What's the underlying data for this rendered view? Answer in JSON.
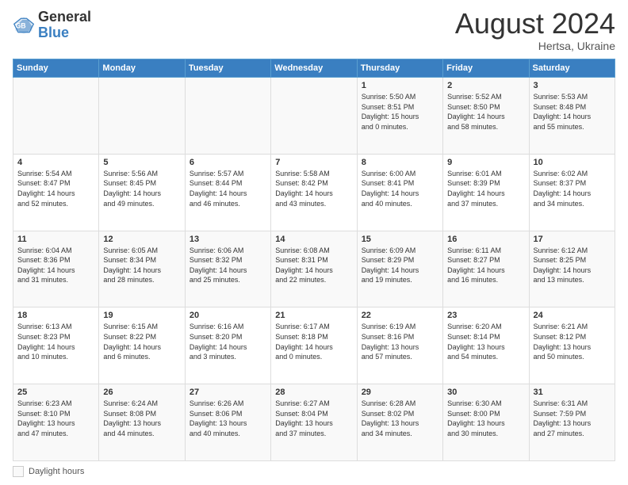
{
  "logo": {
    "line1": "General",
    "line2": "Blue"
  },
  "title": "August 2024",
  "subtitle": "Hertsa, Ukraine",
  "days_header": [
    "Sunday",
    "Monday",
    "Tuesday",
    "Wednesday",
    "Thursday",
    "Friday",
    "Saturday"
  ],
  "legend_label": "Daylight hours",
  "weeks": [
    [
      {
        "num": "",
        "info": ""
      },
      {
        "num": "",
        "info": ""
      },
      {
        "num": "",
        "info": ""
      },
      {
        "num": "",
        "info": ""
      },
      {
        "num": "1",
        "info": "Sunrise: 5:50 AM\nSunset: 8:51 PM\nDaylight: 15 hours\nand 0 minutes."
      },
      {
        "num": "2",
        "info": "Sunrise: 5:52 AM\nSunset: 8:50 PM\nDaylight: 14 hours\nand 58 minutes."
      },
      {
        "num": "3",
        "info": "Sunrise: 5:53 AM\nSunset: 8:48 PM\nDaylight: 14 hours\nand 55 minutes."
      }
    ],
    [
      {
        "num": "4",
        "info": "Sunrise: 5:54 AM\nSunset: 8:47 PM\nDaylight: 14 hours\nand 52 minutes."
      },
      {
        "num": "5",
        "info": "Sunrise: 5:56 AM\nSunset: 8:45 PM\nDaylight: 14 hours\nand 49 minutes."
      },
      {
        "num": "6",
        "info": "Sunrise: 5:57 AM\nSunset: 8:44 PM\nDaylight: 14 hours\nand 46 minutes."
      },
      {
        "num": "7",
        "info": "Sunrise: 5:58 AM\nSunset: 8:42 PM\nDaylight: 14 hours\nand 43 minutes."
      },
      {
        "num": "8",
        "info": "Sunrise: 6:00 AM\nSunset: 8:41 PM\nDaylight: 14 hours\nand 40 minutes."
      },
      {
        "num": "9",
        "info": "Sunrise: 6:01 AM\nSunset: 8:39 PM\nDaylight: 14 hours\nand 37 minutes."
      },
      {
        "num": "10",
        "info": "Sunrise: 6:02 AM\nSunset: 8:37 PM\nDaylight: 14 hours\nand 34 minutes."
      }
    ],
    [
      {
        "num": "11",
        "info": "Sunrise: 6:04 AM\nSunset: 8:36 PM\nDaylight: 14 hours\nand 31 minutes."
      },
      {
        "num": "12",
        "info": "Sunrise: 6:05 AM\nSunset: 8:34 PM\nDaylight: 14 hours\nand 28 minutes."
      },
      {
        "num": "13",
        "info": "Sunrise: 6:06 AM\nSunset: 8:32 PM\nDaylight: 14 hours\nand 25 minutes."
      },
      {
        "num": "14",
        "info": "Sunrise: 6:08 AM\nSunset: 8:31 PM\nDaylight: 14 hours\nand 22 minutes."
      },
      {
        "num": "15",
        "info": "Sunrise: 6:09 AM\nSunset: 8:29 PM\nDaylight: 14 hours\nand 19 minutes."
      },
      {
        "num": "16",
        "info": "Sunrise: 6:11 AM\nSunset: 8:27 PM\nDaylight: 14 hours\nand 16 minutes."
      },
      {
        "num": "17",
        "info": "Sunrise: 6:12 AM\nSunset: 8:25 PM\nDaylight: 14 hours\nand 13 minutes."
      }
    ],
    [
      {
        "num": "18",
        "info": "Sunrise: 6:13 AM\nSunset: 8:23 PM\nDaylight: 14 hours\nand 10 minutes."
      },
      {
        "num": "19",
        "info": "Sunrise: 6:15 AM\nSunset: 8:22 PM\nDaylight: 14 hours\nand 6 minutes."
      },
      {
        "num": "20",
        "info": "Sunrise: 6:16 AM\nSunset: 8:20 PM\nDaylight: 14 hours\nand 3 minutes."
      },
      {
        "num": "21",
        "info": "Sunrise: 6:17 AM\nSunset: 8:18 PM\nDaylight: 14 hours\nand 0 minutes."
      },
      {
        "num": "22",
        "info": "Sunrise: 6:19 AM\nSunset: 8:16 PM\nDaylight: 13 hours\nand 57 minutes."
      },
      {
        "num": "23",
        "info": "Sunrise: 6:20 AM\nSunset: 8:14 PM\nDaylight: 13 hours\nand 54 minutes."
      },
      {
        "num": "24",
        "info": "Sunrise: 6:21 AM\nSunset: 8:12 PM\nDaylight: 13 hours\nand 50 minutes."
      }
    ],
    [
      {
        "num": "25",
        "info": "Sunrise: 6:23 AM\nSunset: 8:10 PM\nDaylight: 13 hours\nand 47 minutes."
      },
      {
        "num": "26",
        "info": "Sunrise: 6:24 AM\nSunset: 8:08 PM\nDaylight: 13 hours\nand 44 minutes."
      },
      {
        "num": "27",
        "info": "Sunrise: 6:26 AM\nSunset: 8:06 PM\nDaylight: 13 hours\nand 40 minutes."
      },
      {
        "num": "28",
        "info": "Sunrise: 6:27 AM\nSunset: 8:04 PM\nDaylight: 13 hours\nand 37 minutes."
      },
      {
        "num": "29",
        "info": "Sunrise: 6:28 AM\nSunset: 8:02 PM\nDaylight: 13 hours\nand 34 minutes."
      },
      {
        "num": "30",
        "info": "Sunrise: 6:30 AM\nSunset: 8:00 PM\nDaylight: 13 hours\nand 30 minutes."
      },
      {
        "num": "31",
        "info": "Sunrise: 6:31 AM\nSunset: 7:59 PM\nDaylight: 13 hours\nand 27 minutes."
      }
    ]
  ]
}
